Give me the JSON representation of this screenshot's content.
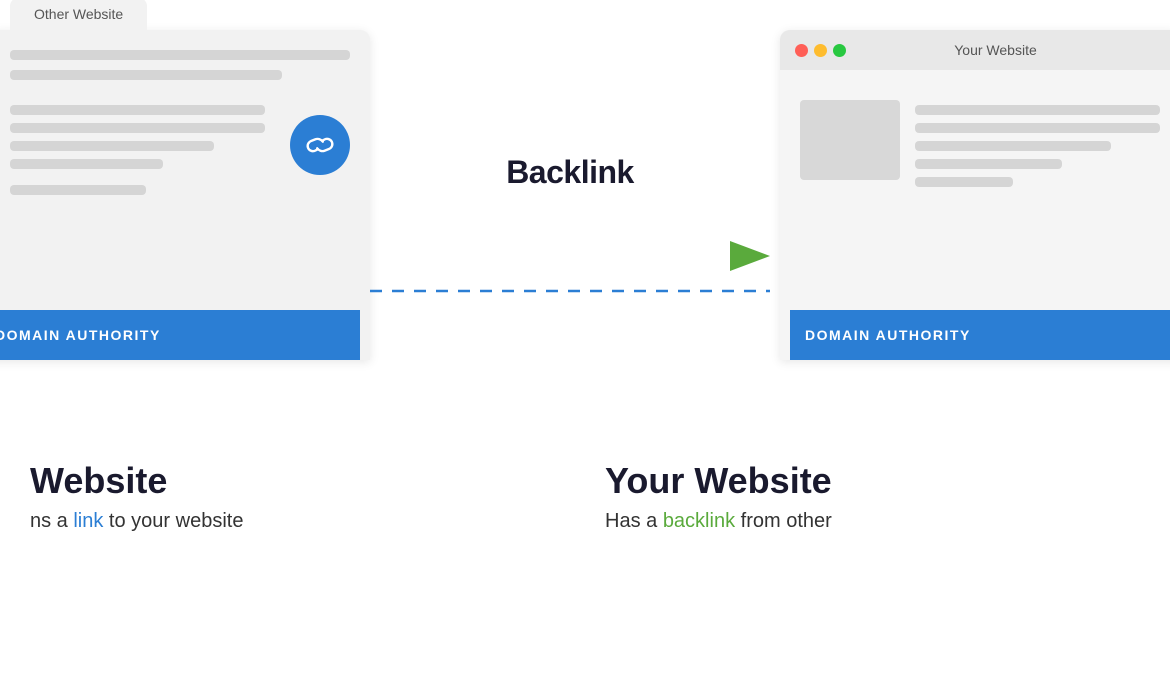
{
  "left_window": {
    "tab_label": "Other Website",
    "domain_authority": "DOMAIN AUTHORITY"
  },
  "right_window": {
    "tab_label": "Your Website",
    "domain_authority": "DOMAIN AUTHORITY",
    "traffic_lights": [
      "red",
      "yellow",
      "green"
    ]
  },
  "center": {
    "backlink_label": "Backlink"
  },
  "bottom_left": {
    "title": "Website",
    "description_prefix": "ns a ",
    "link_word": "link",
    "description_suffix": " to your website"
  },
  "bottom_right": {
    "title": "Your Website",
    "description_prefix": "Has a ",
    "link_word": "backlink",
    "description_suffix": " from other"
  },
  "colors": {
    "blue": "#2b7ed4",
    "green": "#5aaa3c",
    "dark": "#1a1a2e",
    "gray_bg": "#f2f2f2",
    "gray_line": "#d5d5d5"
  }
}
